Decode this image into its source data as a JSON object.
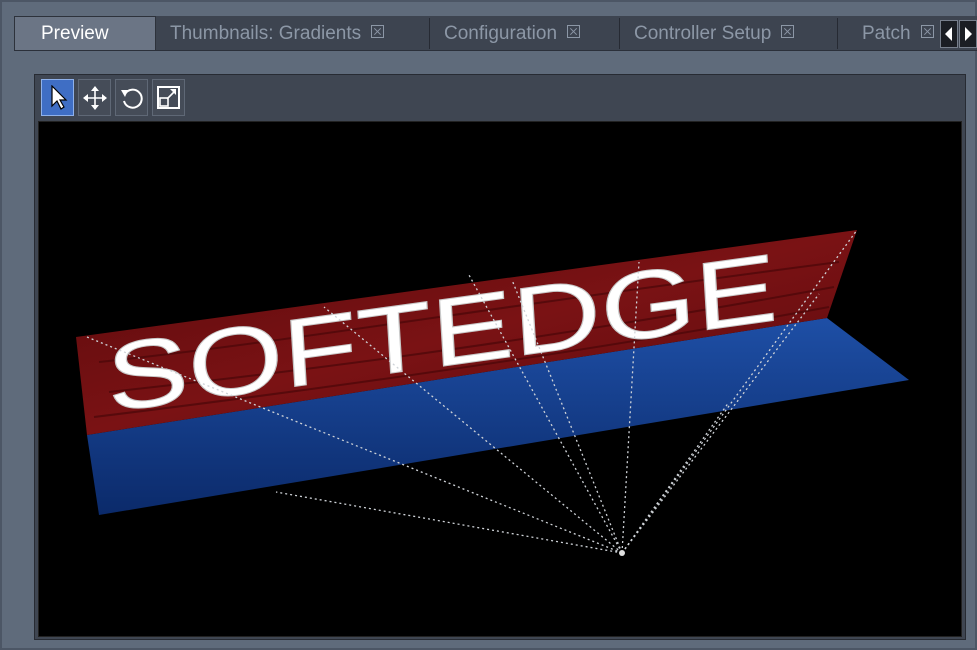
{
  "tabs": [
    {
      "label": "Preview",
      "active": true,
      "closable": false
    },
    {
      "label": "Thumbnails: Gradients",
      "active": false,
      "closable": true
    },
    {
      "label": "Configuration",
      "active": false,
      "closable": true
    },
    {
      "label": "Controller Setup",
      "active": false,
      "closable": true
    },
    {
      "label": "Patch",
      "active": false,
      "closable": true
    }
  ],
  "toolbar": {
    "tools": [
      "pointer-icon",
      "move-icon",
      "rotate-icon",
      "scale-icon"
    ],
    "active_tool": "pointer-icon"
  },
  "scene": {
    "text": "SOFTEDGE",
    "wall_color": "#6e0d0f",
    "floor_color": "#123c8c",
    "text_color": "#ffffff",
    "projector_line_color": "#cfd3d8"
  }
}
